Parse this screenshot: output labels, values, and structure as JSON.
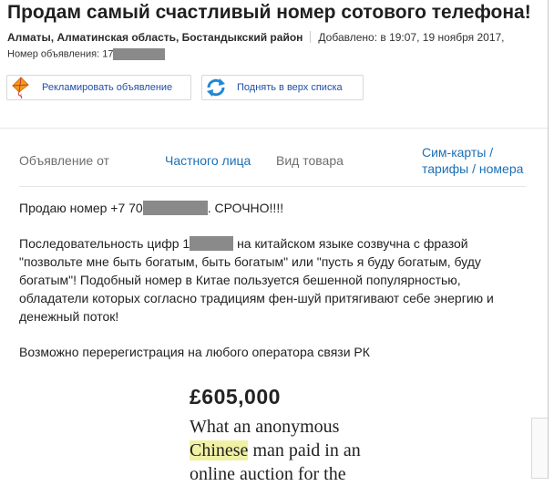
{
  "ad": {
    "title": "Продам самый счастливый номер сотового телефона!",
    "location": "Алматы, Алматинская область, Бостандыкский район",
    "added": "Добавлено: в 19:07, 19 ноября 2017,",
    "number_label": "Номер объявления: 17"
  },
  "actions": {
    "promote_label": "Рекламировать объявление",
    "promote_icon": "kite-icon",
    "lift_label": "Поднять в верх списка",
    "lift_icon": "refresh-arrows-icon"
  },
  "params": {
    "from_label": "Объявление от",
    "from_value": "Частного лица",
    "type_label": "Вид товара",
    "type_value_line1": "Сим-карты /",
    "type_value_line2": "тарифы / номера"
  },
  "description": {
    "p1_start": "Продаю номер +7 70",
    "p1_end": ". СРОЧНО!!!!",
    "p2_start": "Последовательность цифр 1",
    "p2_end": " на китайском языке созвучна с фразой \"позвольте мне быть богатым, быть богатым\" или \"пусть я буду богатым, буду богатым\"! Подобный номер в Китае пользуется бешенной популярностью, обладатели которых согласно традициям фен-шуй притягивают себе энергию и денежный поток!",
    "p3": "Возможно перерегистрация на любого оператора связи РК"
  },
  "image_text": {
    "price": "£605,000",
    "line1": "What an anonymous",
    "line2_highlight": "Chinese",
    "line2_rest": " man paid in an",
    "line3": "online auction for the"
  },
  "colors": {
    "link": "#1c6fb5",
    "button_text": "#1f4fa8",
    "redaction": "#8a8a8a",
    "highlight": "#f0f1a4"
  }
}
